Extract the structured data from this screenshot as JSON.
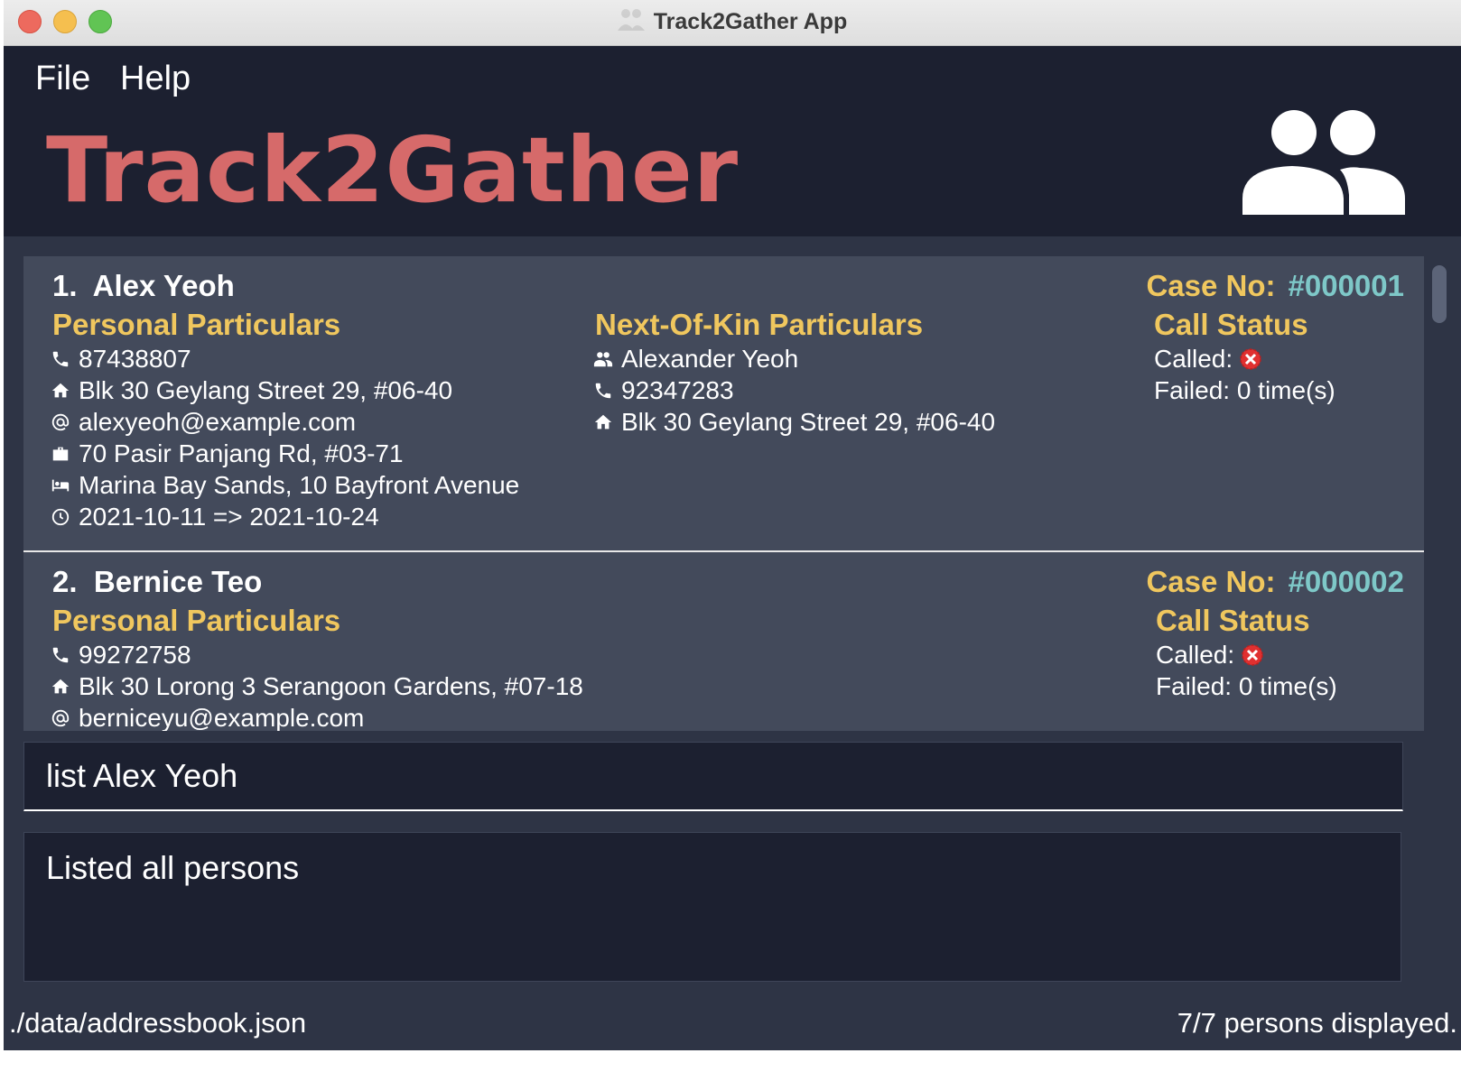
{
  "window": {
    "title": "Track2Gather App"
  },
  "menu": {
    "file": "File",
    "help": "Help"
  },
  "header": {
    "app_title": "Track2Gather"
  },
  "persons": [
    {
      "index": "1.",
      "name": "Alex Yeoh",
      "case_label": "Case No:",
      "case_no": "#000001",
      "personal_heading": "Personal Particulars",
      "phone": "87438807",
      "home": "Blk 30 Geylang Street 29, #06-40",
      "email": "alexyeoh@example.com",
      "work": "70 Pasir Panjang Rd, #03-71",
      "quarantine": "Marina Bay Sands, 10 Bayfront Avenue",
      "period": "2021-10-11 => 2021-10-24",
      "nok_heading": "Next-Of-Kin Particulars",
      "nok_name": "Alexander Yeoh",
      "nok_phone": "92347283",
      "nok_address": "Blk 30 Geylang Street 29, #06-40",
      "call_heading": "Call Status",
      "called_label": "Called:",
      "failed": "Failed: 0 time(s)"
    },
    {
      "index": "2.",
      "name": "Bernice Teo",
      "case_label": "Case No:",
      "case_no": "#000002",
      "personal_heading": "Personal Particulars",
      "phone": "99272758",
      "home": "Blk 30 Lorong 3 Serangoon Gardens, #07-18",
      "email": "berniceyu@example.com",
      "call_heading": "Call Status",
      "called_label": "Called:",
      "failed": "Failed: 0 time(s)"
    }
  ],
  "command": {
    "value": "list Alex Yeoh"
  },
  "result": {
    "text": "Listed all persons"
  },
  "status": {
    "file_path": "./data/addressbook.json",
    "count": "7/7 persons displayed."
  },
  "colors": {
    "background": "#1c2030",
    "panel": "#2e3445",
    "card": "#434a5b",
    "title_red": "#d66a6a",
    "heading_yellow": "#f0c75e",
    "case_teal": "#7ec8c8",
    "status_x_red": "#e03030"
  },
  "icons": {
    "logo": "people-icon",
    "phone": "phone-icon",
    "home": "home-icon",
    "email": "at-icon",
    "work": "briefcase-icon",
    "quarantine": "bed-icon",
    "period": "clock-icon",
    "nok": "people-icon",
    "called": "x-circle-icon"
  }
}
